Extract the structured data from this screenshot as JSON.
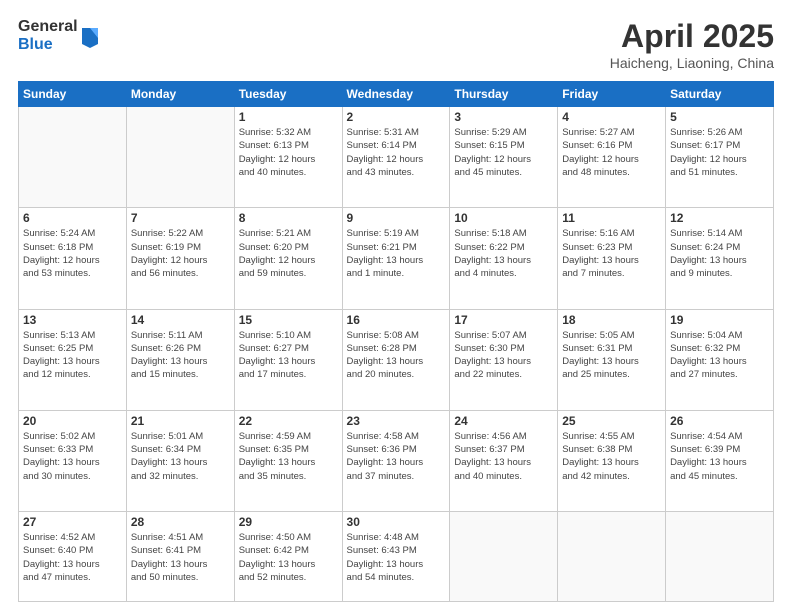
{
  "header": {
    "logo_general": "General",
    "logo_blue": "Blue",
    "title": "April 2025",
    "location": "Haicheng, Liaoning, China"
  },
  "days_of_week": [
    "Sunday",
    "Monday",
    "Tuesday",
    "Wednesday",
    "Thursday",
    "Friday",
    "Saturday"
  ],
  "weeks": [
    [
      {
        "day": "",
        "info": ""
      },
      {
        "day": "",
        "info": ""
      },
      {
        "day": "1",
        "info": "Sunrise: 5:32 AM\nSunset: 6:13 PM\nDaylight: 12 hours\nand 40 minutes."
      },
      {
        "day": "2",
        "info": "Sunrise: 5:31 AM\nSunset: 6:14 PM\nDaylight: 12 hours\nand 43 minutes."
      },
      {
        "day": "3",
        "info": "Sunrise: 5:29 AM\nSunset: 6:15 PM\nDaylight: 12 hours\nand 45 minutes."
      },
      {
        "day": "4",
        "info": "Sunrise: 5:27 AM\nSunset: 6:16 PM\nDaylight: 12 hours\nand 48 minutes."
      },
      {
        "day": "5",
        "info": "Sunrise: 5:26 AM\nSunset: 6:17 PM\nDaylight: 12 hours\nand 51 minutes."
      }
    ],
    [
      {
        "day": "6",
        "info": "Sunrise: 5:24 AM\nSunset: 6:18 PM\nDaylight: 12 hours\nand 53 minutes."
      },
      {
        "day": "7",
        "info": "Sunrise: 5:22 AM\nSunset: 6:19 PM\nDaylight: 12 hours\nand 56 minutes."
      },
      {
        "day": "8",
        "info": "Sunrise: 5:21 AM\nSunset: 6:20 PM\nDaylight: 12 hours\nand 59 minutes."
      },
      {
        "day": "9",
        "info": "Sunrise: 5:19 AM\nSunset: 6:21 PM\nDaylight: 13 hours\nand 1 minute."
      },
      {
        "day": "10",
        "info": "Sunrise: 5:18 AM\nSunset: 6:22 PM\nDaylight: 13 hours\nand 4 minutes."
      },
      {
        "day": "11",
        "info": "Sunrise: 5:16 AM\nSunset: 6:23 PM\nDaylight: 13 hours\nand 7 minutes."
      },
      {
        "day": "12",
        "info": "Sunrise: 5:14 AM\nSunset: 6:24 PM\nDaylight: 13 hours\nand 9 minutes."
      }
    ],
    [
      {
        "day": "13",
        "info": "Sunrise: 5:13 AM\nSunset: 6:25 PM\nDaylight: 13 hours\nand 12 minutes."
      },
      {
        "day": "14",
        "info": "Sunrise: 5:11 AM\nSunset: 6:26 PM\nDaylight: 13 hours\nand 15 minutes."
      },
      {
        "day": "15",
        "info": "Sunrise: 5:10 AM\nSunset: 6:27 PM\nDaylight: 13 hours\nand 17 minutes."
      },
      {
        "day": "16",
        "info": "Sunrise: 5:08 AM\nSunset: 6:28 PM\nDaylight: 13 hours\nand 20 minutes."
      },
      {
        "day": "17",
        "info": "Sunrise: 5:07 AM\nSunset: 6:30 PM\nDaylight: 13 hours\nand 22 minutes."
      },
      {
        "day": "18",
        "info": "Sunrise: 5:05 AM\nSunset: 6:31 PM\nDaylight: 13 hours\nand 25 minutes."
      },
      {
        "day": "19",
        "info": "Sunrise: 5:04 AM\nSunset: 6:32 PM\nDaylight: 13 hours\nand 27 minutes."
      }
    ],
    [
      {
        "day": "20",
        "info": "Sunrise: 5:02 AM\nSunset: 6:33 PM\nDaylight: 13 hours\nand 30 minutes."
      },
      {
        "day": "21",
        "info": "Sunrise: 5:01 AM\nSunset: 6:34 PM\nDaylight: 13 hours\nand 32 minutes."
      },
      {
        "day": "22",
        "info": "Sunrise: 4:59 AM\nSunset: 6:35 PM\nDaylight: 13 hours\nand 35 minutes."
      },
      {
        "day": "23",
        "info": "Sunrise: 4:58 AM\nSunset: 6:36 PM\nDaylight: 13 hours\nand 37 minutes."
      },
      {
        "day": "24",
        "info": "Sunrise: 4:56 AM\nSunset: 6:37 PM\nDaylight: 13 hours\nand 40 minutes."
      },
      {
        "day": "25",
        "info": "Sunrise: 4:55 AM\nSunset: 6:38 PM\nDaylight: 13 hours\nand 42 minutes."
      },
      {
        "day": "26",
        "info": "Sunrise: 4:54 AM\nSunset: 6:39 PM\nDaylight: 13 hours\nand 45 minutes."
      }
    ],
    [
      {
        "day": "27",
        "info": "Sunrise: 4:52 AM\nSunset: 6:40 PM\nDaylight: 13 hours\nand 47 minutes."
      },
      {
        "day": "28",
        "info": "Sunrise: 4:51 AM\nSunset: 6:41 PM\nDaylight: 13 hours\nand 50 minutes."
      },
      {
        "day": "29",
        "info": "Sunrise: 4:50 AM\nSunset: 6:42 PM\nDaylight: 13 hours\nand 52 minutes."
      },
      {
        "day": "30",
        "info": "Sunrise: 4:48 AM\nSunset: 6:43 PM\nDaylight: 13 hours\nand 54 minutes."
      },
      {
        "day": "",
        "info": ""
      },
      {
        "day": "",
        "info": ""
      },
      {
        "day": "",
        "info": ""
      }
    ]
  ]
}
